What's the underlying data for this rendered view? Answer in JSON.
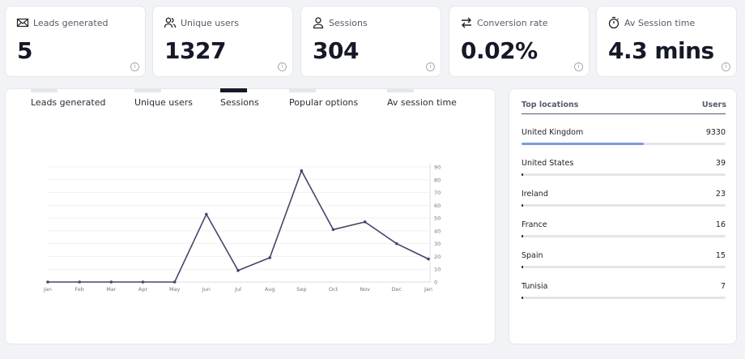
{
  "cards": [
    {
      "label": "Leads generated",
      "value": "5",
      "icon": "mail-icon"
    },
    {
      "label": "Unique users",
      "value": "1327",
      "icon": "users-icon"
    },
    {
      "label": "Sessions",
      "value": "304",
      "icon": "user-icon"
    },
    {
      "label": "Conversion rate",
      "value": "0.02%",
      "icon": "swap-arrows-icon"
    },
    {
      "label": "Av Session time",
      "value": "4.3 mins",
      "icon": "stopwatch-icon"
    }
  ],
  "info_glyph": "i",
  "tabs": [
    {
      "label": "Leads generated",
      "active": false
    },
    {
      "label": "Unique users",
      "active": false
    },
    {
      "label": "Sessions",
      "active": true
    },
    {
      "label": "Popular options",
      "active": false
    },
    {
      "label": "Av session time",
      "active": false
    }
  ],
  "locations": {
    "header_name": "Top locations",
    "header_count": "Users",
    "items": [
      {
        "name": "United Kingdom",
        "count": "9330",
        "fraction": 0.6
      },
      {
        "name": "United States",
        "count": "39",
        "fraction": 0.005
      },
      {
        "name": "Ireland",
        "count": "23",
        "fraction": 0.003
      },
      {
        "name": "France",
        "count": "16",
        "fraction": 0.002
      },
      {
        "name": "Spain",
        "count": "15",
        "fraction": 0.002
      },
      {
        "name": "Tunisia",
        "count": "7",
        "fraction": 0.001
      }
    ]
  },
  "chart_data": {
    "type": "line",
    "categories": [
      "Jan",
      "Feb",
      "Mar",
      "Apr",
      "May",
      "Jun",
      "Jul",
      "Aug",
      "Sep",
      "Oct",
      "Nov",
      "Dec",
      "Jan"
    ],
    "values": [
      0,
      0,
      0,
      0,
      0,
      53,
      9,
      19,
      87,
      41,
      47,
      30,
      18
    ],
    "ylim": [
      0,
      90
    ],
    "yticks": [
      0,
      10,
      20,
      30,
      40,
      50,
      60,
      70,
      80,
      90
    ],
    "y_axis_side": "right",
    "grid": true,
    "line_color": "#45466a"
  }
}
